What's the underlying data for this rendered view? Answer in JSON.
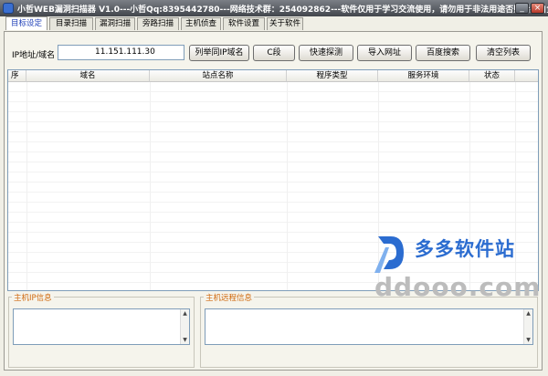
{
  "window": {
    "title": "小哲WEB漏洞扫描器 V1.0---小哲Qq:8395442780---网络技术群：254092862---软件仅用于学习交流使用，请勿用于非法用途否则后果自负",
    "minimize_glyph": "_",
    "close_glyph": "×"
  },
  "tabs": [
    {
      "label": "目标设定"
    },
    {
      "label": "目录扫描"
    },
    {
      "label": "漏洞扫描"
    },
    {
      "label": "旁路扫描"
    },
    {
      "label": "主机侦查"
    },
    {
      "label": "软件设置"
    },
    {
      "label": "关于软件"
    }
  ],
  "target": {
    "ip_label": "IP地址/域名",
    "ip_value": "11.151.111.30"
  },
  "buttons": {
    "list_same_ip": "列举同IP域名",
    "c_segment": "C段",
    "quick_probe": "快速探测",
    "import_url": "导入网址",
    "baidu_search": "百度搜索",
    "clear_list": "清空列表"
  },
  "table": {
    "columns": [
      "序",
      "域名",
      "站点名称",
      "程序类型",
      "服务环境",
      "状态"
    ]
  },
  "host_ip_info": {
    "title": "主机IP信息"
  },
  "host_remote_info": {
    "title": "主机远程信息"
  },
  "watermark": {
    "cn": "多多软件站",
    "en": "ddooo.com"
  }
}
